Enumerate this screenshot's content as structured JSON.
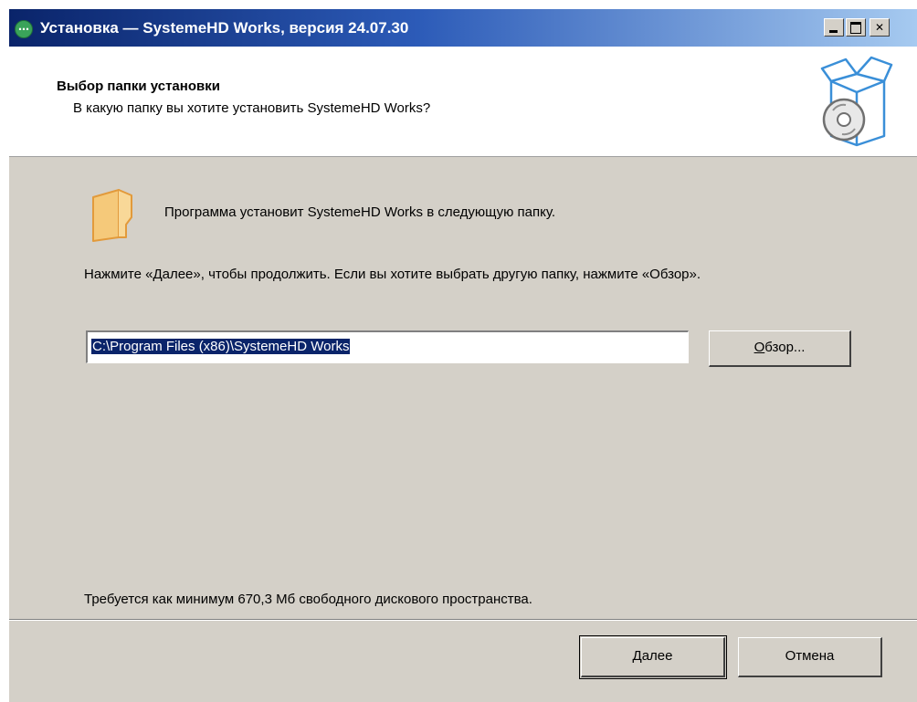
{
  "window": {
    "title": "Установка — SystemeHD Works, версия 24.07.30",
    "icon": "installer-app-icon"
  },
  "titlebar_buttons": {
    "minimize_icon": "minimize-icon",
    "maximize_icon": "maximize-icon",
    "close_glyph": "✕"
  },
  "header": {
    "title": "Выбор папки установки",
    "subtitle": "В какую папку вы хотите установить SystemeHD Works?",
    "icon": "install-box-cd-icon"
  },
  "body": {
    "folder_text": "Программа установит SystemeHD Works в следующую папку.",
    "instruction": "Нажмите «Далее», чтобы продолжить. Если вы хотите выбрать другую папку, нажмите «Обзор».",
    "path_value": "C:\\Program Files (x86)\\SystemeHD Works",
    "browse_prefix": "",
    "browse_accel": "О",
    "browse_rest": "бзор...",
    "disk_space": "Требуется как минимум 670,3 Мб свободного дискового пространства."
  },
  "footer": {
    "next_accel": "Д",
    "next_rest": "алее",
    "cancel_label": "Отмена"
  },
  "colors": {
    "titlebar_start": "#0a246a",
    "titlebar_end": "#a6caf0",
    "dialog_bg": "#d4d0c8",
    "selection": "#0a246a",
    "folder_fill": "#f5c97a",
    "box_outline": "#3a8fd8"
  }
}
